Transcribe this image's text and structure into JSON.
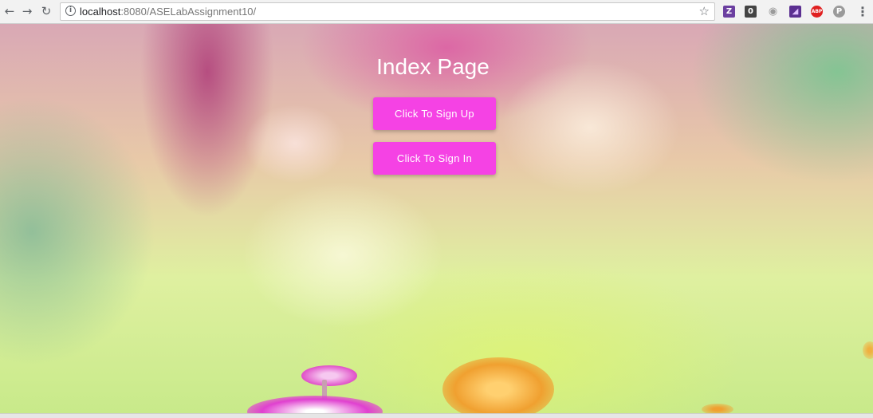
{
  "browser": {
    "url_host": "localhost",
    "url_rest": ":8080/ASELabAssignment10/",
    "extensions": [
      {
        "icon": "zotero-icon",
        "glyph": "Z",
        "color": "#6b3fa0"
      },
      {
        "icon": "shield-extension-icon",
        "glyph": "0",
        "color": "#444444"
      },
      {
        "icon": "camera-icon",
        "glyph": "◉",
        "color": "#9a9a9a"
      },
      {
        "icon": "purple-extension-icon",
        "glyph": "◢",
        "color": "#5b2f91"
      },
      {
        "icon": "adblock-plus-icon",
        "glyph": "ABP",
        "color": "#e02020"
      },
      {
        "icon": "p-extension-icon",
        "glyph": "P",
        "color": "#9a9a9a"
      }
    ]
  },
  "page": {
    "title": "Index Page",
    "signup_label": "Click To Sign Up",
    "signin_label": "Click To Sign In",
    "accent_color": "#f542e4"
  }
}
